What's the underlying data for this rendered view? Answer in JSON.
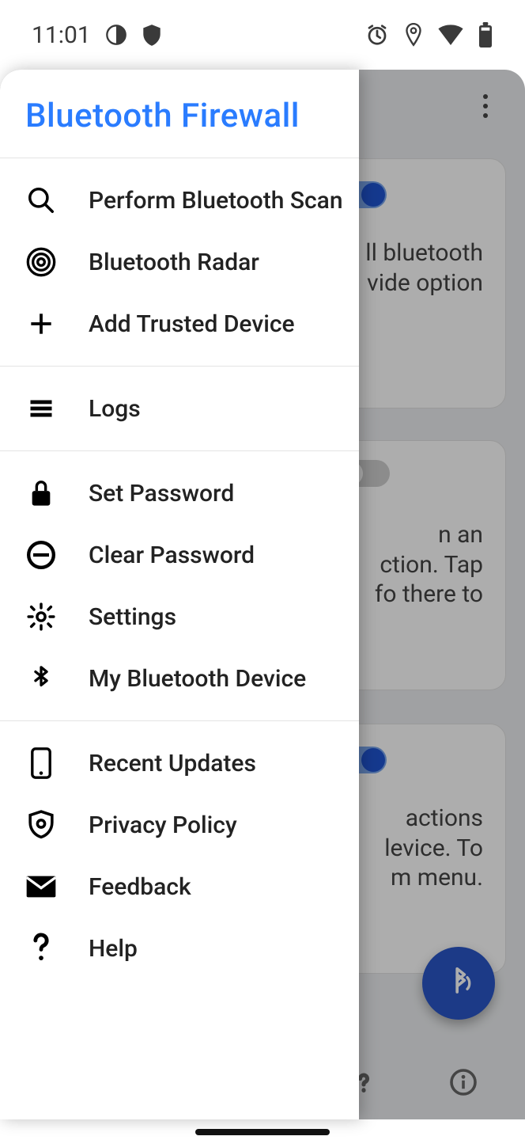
{
  "statusbar": {
    "time": "11:01"
  },
  "drawer": {
    "title": "Bluetooth Firewall",
    "items": {
      "scan": "Perform Bluetooth Scan",
      "radar": "Bluetooth Radar",
      "add_trusted": "Add Trusted Device",
      "logs": "Logs",
      "set_password": "Set Password",
      "clear_password": "Clear Password",
      "settings": "Settings",
      "my_device": "My Bluetooth Device",
      "recent_updates": "Recent Updates",
      "privacy": "Privacy Policy",
      "feedback": "Feedback",
      "help": "Help"
    }
  },
  "background": {
    "card1_text": "ll bluetooth\nvide option",
    "card2_text": "n an\nction. Tap\nfo there to",
    "card3_text": "actions\nlevice. To\nm menu.",
    "toggles": {
      "card1": true,
      "card2": false,
      "card3": true
    }
  }
}
